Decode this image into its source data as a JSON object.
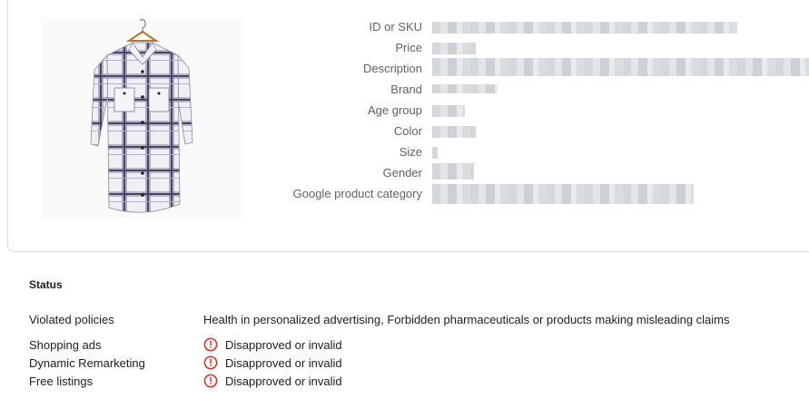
{
  "product": {
    "attributes": [
      {
        "key": "id",
        "label": "ID or SKU"
      },
      {
        "key": "price",
        "label": "Price"
      },
      {
        "key": "description",
        "label": "Description"
      },
      {
        "key": "brand",
        "label": "Brand"
      },
      {
        "key": "age_group",
        "label": "Age group"
      },
      {
        "key": "color",
        "label": "Color"
      },
      {
        "key": "size",
        "label": "Size"
      },
      {
        "key": "gender",
        "label": "Gender"
      },
      {
        "key": "google_product_category",
        "label": "Google product category"
      }
    ],
    "image_icon": "plaid-shirt-dress-image",
    "values_obscured": true
  },
  "status": {
    "title": "Status",
    "violated_policies_label": "Violated policies",
    "violated_policies_value": "Health in personalized advertising, Forbidden pharmaceuticals or products making misleading claims",
    "destinations": [
      {
        "label": "Shopping ads",
        "status": "Disapproved or invalid"
      },
      {
        "label": "Dynamic Remarketing",
        "status": "Disapproved or invalid"
      },
      {
        "label": "Free listings",
        "status": "Disapproved or invalid"
      }
    ],
    "error_icon": "error-circle-icon",
    "error_color": "#d93025"
  }
}
